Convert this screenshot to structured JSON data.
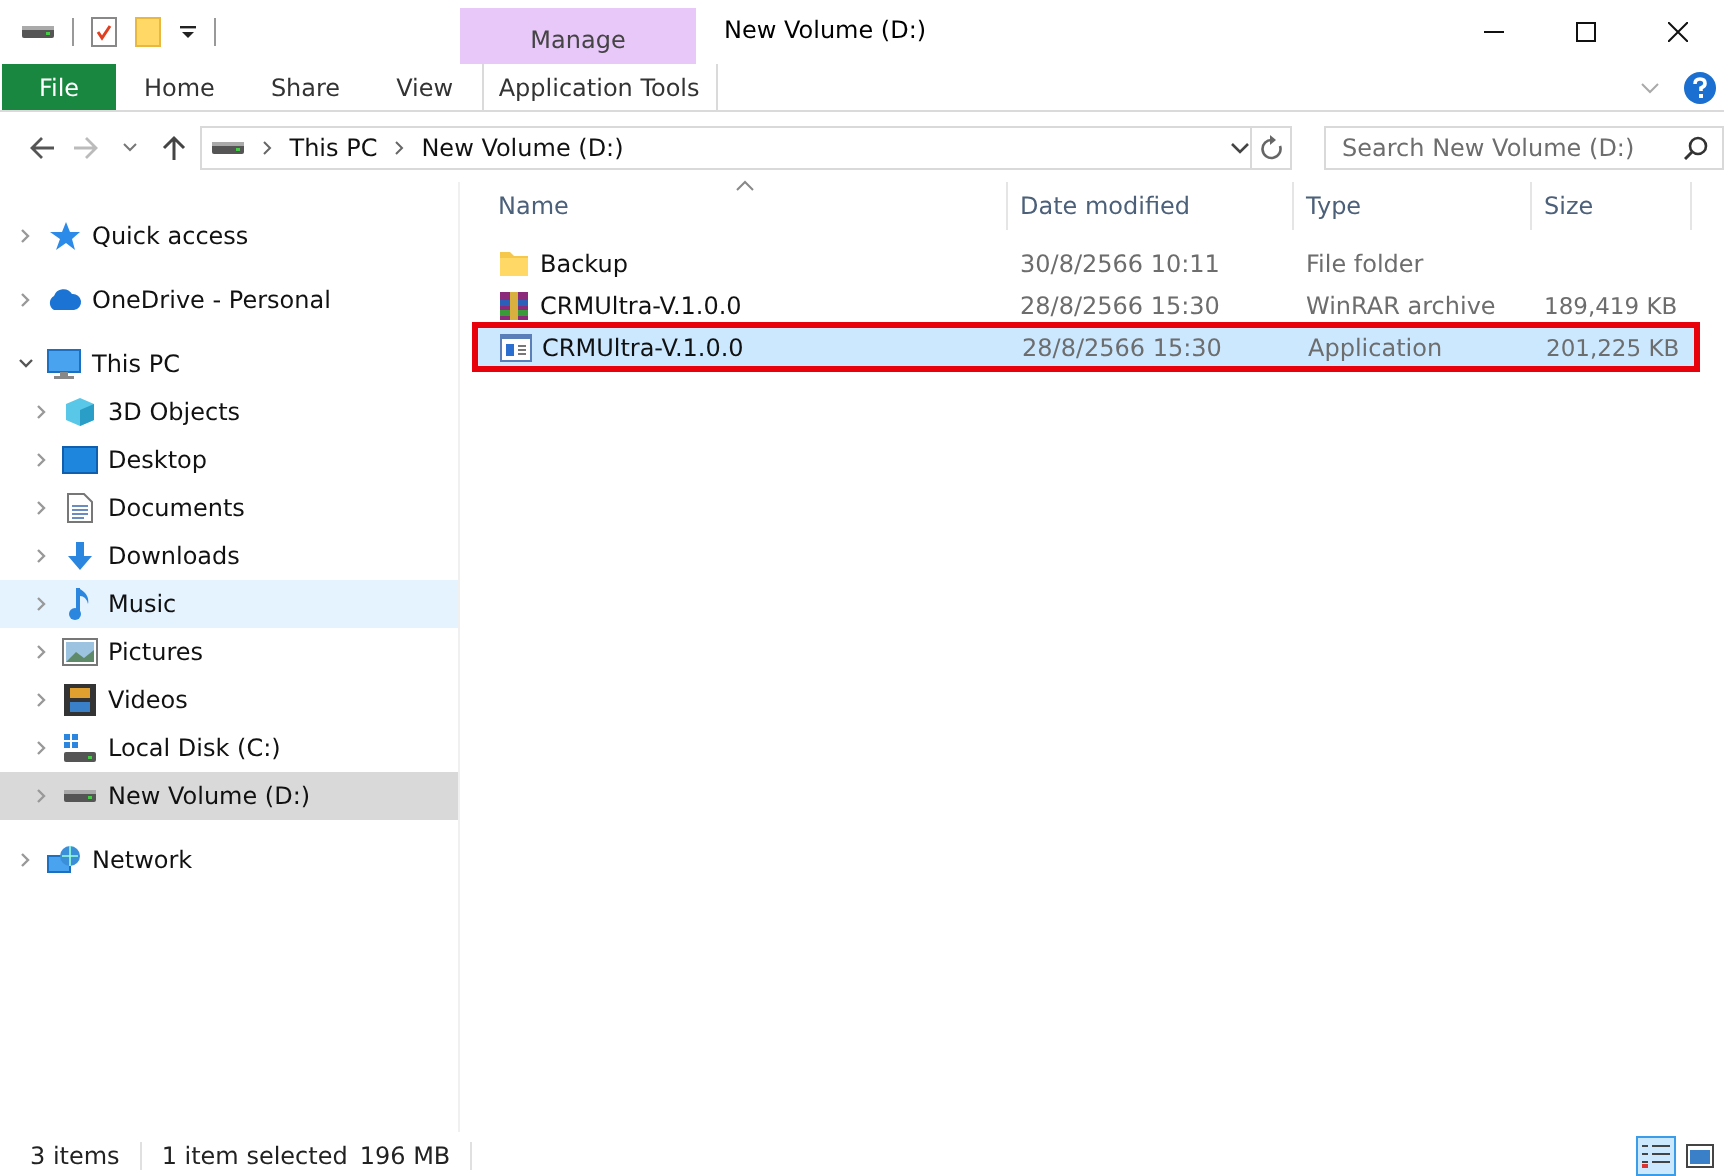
{
  "window": {
    "title": "New Volume (D:)"
  },
  "contextual_tab": {
    "label": "Manage"
  },
  "ribbon_tabs": [
    {
      "label": "File",
      "kind": "file",
      "selected": false
    },
    {
      "label": "Home",
      "kind": "tab",
      "selected": false
    },
    {
      "label": "Share",
      "kind": "tab",
      "selected": false
    },
    {
      "label": "View",
      "kind": "tab",
      "selected": false
    },
    {
      "label": "Application Tools",
      "kind": "contextual",
      "selected": false
    }
  ],
  "address": {
    "path": [
      "This PC",
      "New Volume (D:)"
    ]
  },
  "search": {
    "placeholder": "Search New Volume (D:)"
  },
  "nav": [
    {
      "label": "Quick access",
      "kind": "star",
      "expanded": false,
      "selected": false,
      "hovered": false
    },
    {
      "label": "OneDrive - Personal",
      "kind": "cloud",
      "expanded": false,
      "selected": false,
      "hovered": false
    },
    {
      "label": "This PC",
      "kind": "pc",
      "expanded": true,
      "selected": false,
      "hovered": false,
      "children": [
        {
          "label": "3D Objects",
          "kind": "cube",
          "expanded": false,
          "selected": false,
          "hovered": false
        },
        {
          "label": "Desktop",
          "kind": "desktop",
          "expanded": false,
          "selected": false,
          "hovered": false
        },
        {
          "label": "Documents",
          "kind": "doc",
          "expanded": false,
          "selected": false,
          "hovered": false
        },
        {
          "label": "Downloads",
          "kind": "download",
          "expanded": false,
          "selected": false,
          "hovered": false
        },
        {
          "label": "Music",
          "kind": "music",
          "expanded": false,
          "selected": false,
          "hovered": true
        },
        {
          "label": "Pictures",
          "kind": "pictures",
          "expanded": false,
          "selected": false,
          "hovered": false
        },
        {
          "label": "Videos",
          "kind": "video",
          "expanded": false,
          "selected": false,
          "hovered": false
        },
        {
          "label": "Local Disk (C:)",
          "kind": "osdisk",
          "expanded": false,
          "selected": false,
          "hovered": false
        },
        {
          "label": "New Volume (D:)",
          "kind": "disk",
          "expanded": false,
          "selected": true,
          "hovered": false
        }
      ]
    },
    {
      "label": "Network",
      "kind": "network",
      "expanded": false,
      "selected": false,
      "hovered": false
    }
  ],
  "table": {
    "columns": [
      {
        "label": "Name",
        "sorted": true
      },
      {
        "label": "Date modified",
        "sorted": false
      },
      {
        "label": "Type",
        "sorted": false
      },
      {
        "label": "Size",
        "sorted": false
      }
    ],
    "rows": [
      {
        "kind": "folder",
        "name": "Backup",
        "date": "30/8/2566 10:11",
        "type": "File folder",
        "selected": false,
        "highlighted": false
      },
      {
        "kind": "archive",
        "name": "CRMUltra-V.1.0.0",
        "date": "28/8/2566 15:30",
        "type": "WinRAR archive",
        "size": "189,419 KB",
        "selected": false,
        "highlighted": false
      },
      {
        "kind": "application",
        "name": "CRMUltra-V.1.0.0",
        "date": "28/8/2566 15:30",
        "type": "Application",
        "size": "201,225 KB",
        "selected": true,
        "highlighted": true
      }
    ]
  },
  "status_bar": {
    "count": "3 items",
    "selection": "1 item selected",
    "size": "196 MB"
  },
  "view_buttons": [
    {
      "kind": "details",
      "selected": true
    },
    {
      "kind": "tiles",
      "selected": false
    }
  ]
}
